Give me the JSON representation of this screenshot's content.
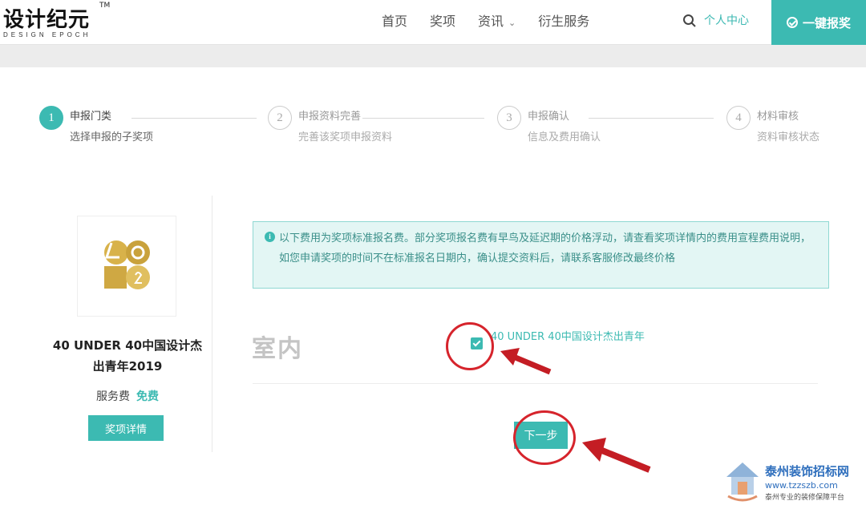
{
  "header": {
    "logo_main": "设计纪元",
    "logo_tm": "TM",
    "logo_sub": "DESIGN EPOCH",
    "nav": [
      {
        "label": "首页"
      },
      {
        "label": "奖项"
      },
      {
        "label": "资讯",
        "has_dropdown": true
      },
      {
        "label": "衍生服务"
      }
    ],
    "search_icon": "search-icon",
    "personal_center": "个人中心",
    "quick_apply": "一键报奖",
    "accent_color": "#3cbab2"
  },
  "steps": [
    {
      "number": "1",
      "title": "申报门类",
      "desc": "选择申报的子奖项",
      "active": true
    },
    {
      "number": "2",
      "title": "申报资料完善",
      "desc": "完善该奖项申报资料",
      "active": false
    },
    {
      "number": "3",
      "title": "申报确认",
      "desc": "信息及费用确认",
      "active": false
    },
    {
      "number": "4",
      "title": "材料审核",
      "desc": "资料审核状态",
      "active": false
    }
  ],
  "award": {
    "title": "40 UNDER 40中国设计杰出青年2019",
    "fee_label": "服务费",
    "fee_value": "免费",
    "detail_button": "奖项详情"
  },
  "notice": {
    "icon": "info-icon",
    "text": "以下费用为奖项标准报名费。部分奖项报名费有早鸟及延迟期的价格浮动，请查看奖项详情内的费用宣程费用说明，如您申请奖项的时间不在标准报名日期内，确认提交资料后，请联系客服修改最终价格"
  },
  "selection": {
    "category": "室内",
    "option_label": "40 UNDER 40中国设计杰出青年",
    "checked": true
  },
  "next_button": "下一步",
  "watermark": {
    "line1": "泰州装饰招标网",
    "line2": "www.tzzszb.com",
    "line3": "泰州专业的装修保障平台"
  }
}
